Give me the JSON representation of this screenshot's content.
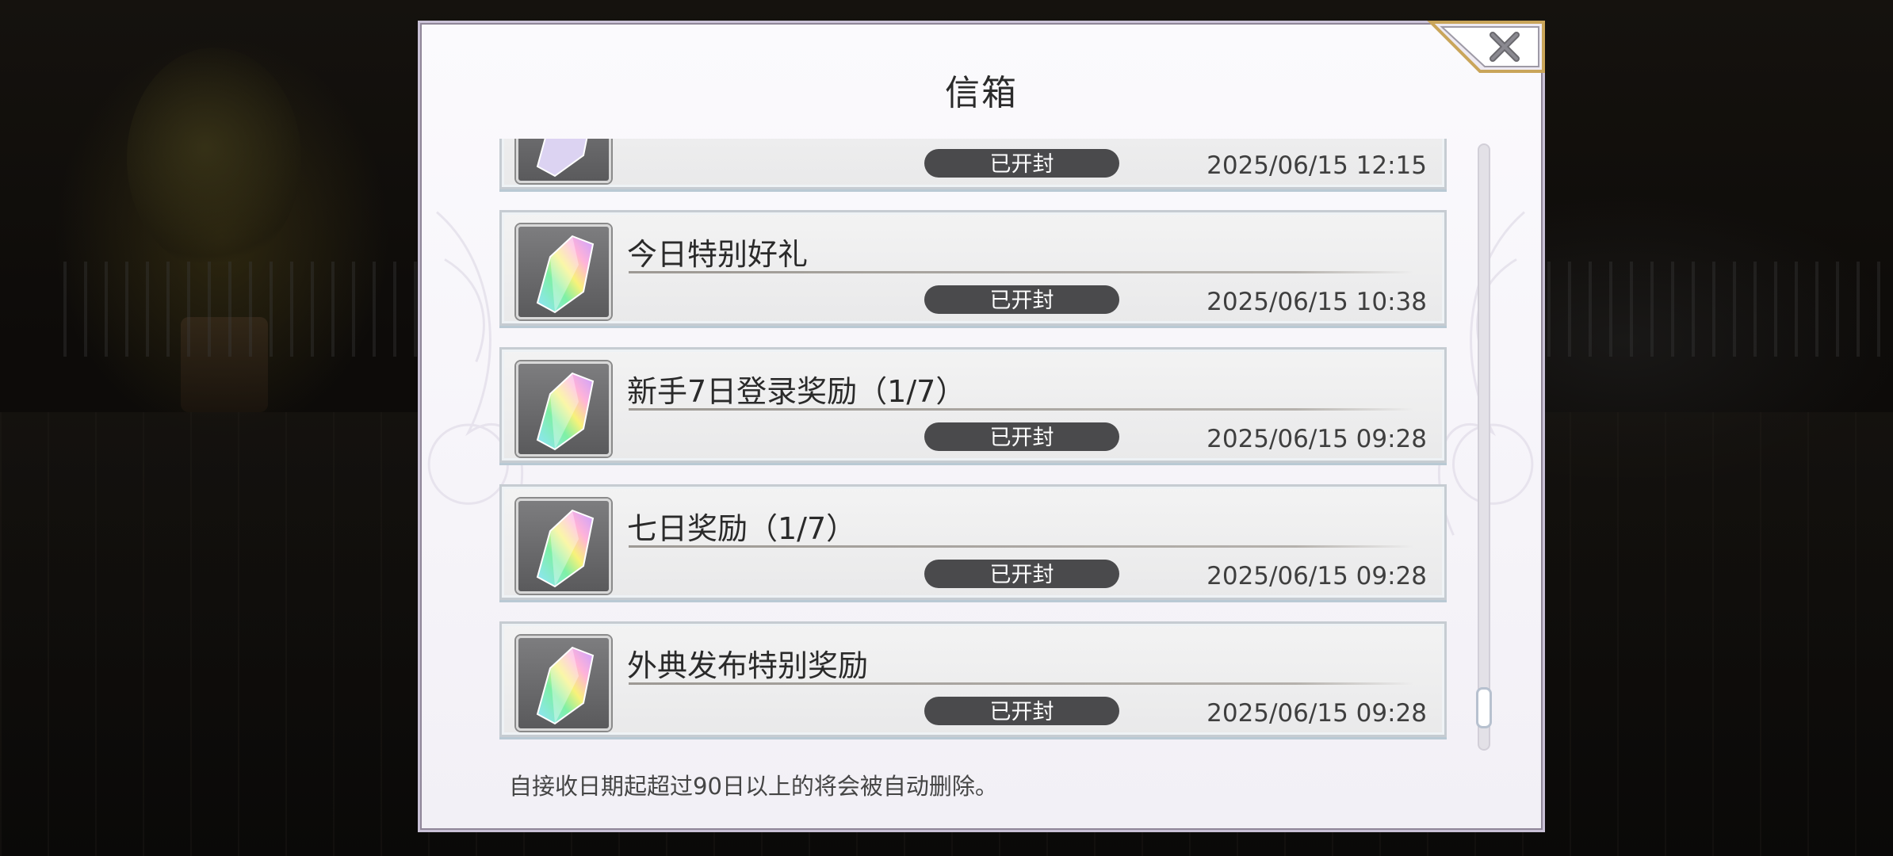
{
  "dialog": {
    "title": "信箱",
    "close_icon": "close-icon",
    "footer_note": "自接收日期起超过90日以上的将会被自动删除。"
  },
  "mail_list": {
    "items": [
      {
        "title": "",
        "status": "已开封",
        "date": "2025/06/15 12:15",
        "icon": "crystal-icon"
      },
      {
        "title": "今日特别好礼",
        "status": "已开封",
        "date": "2025/06/15 10:38",
        "icon": "crystal-icon"
      },
      {
        "title": "新手7日登录奖励（1/7）",
        "status": "已开封",
        "date": "2025/06/15 09:28",
        "icon": "crystal-icon"
      },
      {
        "title": "七日奖励（1/7）",
        "status": "已开封",
        "date": "2025/06/15 09:28",
        "icon": "crystal-icon"
      },
      {
        "title": "外典发布特别奖励",
        "status": "已开封",
        "date": "2025/06/15 09:28",
        "icon": "crystal-icon"
      }
    ]
  },
  "colors": {
    "dialog_bg": "#f6f4f9",
    "status_pill": "#4a4a4c",
    "accent_gold": "#c9a55a"
  }
}
